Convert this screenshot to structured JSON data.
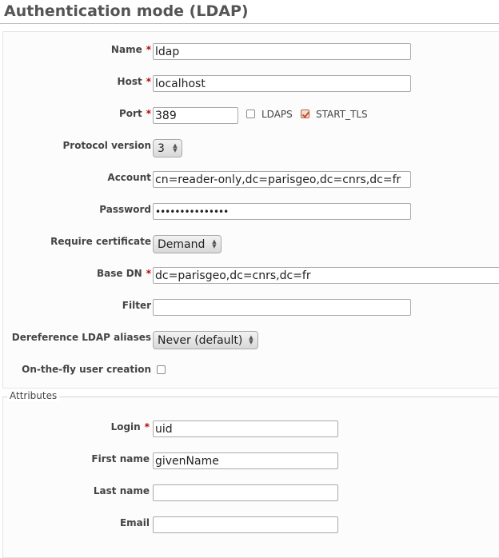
{
  "title": "Authentication mode (LDAP)",
  "required_mark": "*",
  "form": {
    "name": {
      "label": "Name",
      "value": "ldap"
    },
    "host": {
      "label": "Host",
      "value": "localhost"
    },
    "port": {
      "label": "Port",
      "value": "389",
      "ldaps_label": "LDAPS",
      "ldaps_checked": false,
      "start_tls_label": "START_TLS",
      "start_tls_checked": true
    },
    "protocol_version": {
      "label": "Protocol version",
      "value": "3"
    },
    "account": {
      "label": "Account",
      "value": "cn=reader-only,dc=parisgeo,dc=cnrs,dc=fr"
    },
    "password": {
      "label": "Password",
      "value": "•••••••••••••••"
    },
    "require_certificate": {
      "label": "Require certificate",
      "value": "Demand"
    },
    "base_dn": {
      "label": "Base DN",
      "value": "dc=parisgeo,dc=cnrs,dc=fr"
    },
    "filter": {
      "label": "Filter",
      "value": ""
    },
    "dereference": {
      "label": "Dereference LDAP aliases",
      "value": "Never (default)"
    },
    "onthefly": {
      "label": "On-the-fly user creation",
      "checked": false
    }
  },
  "attributes": {
    "legend": "Attributes",
    "login": {
      "label": "Login",
      "value": "uid"
    },
    "firstname": {
      "label": "First name",
      "value": "givenName"
    },
    "lastname": {
      "label": "Last name",
      "value": ""
    },
    "email": {
      "label": "Email",
      "value": ""
    }
  },
  "colors": {
    "required": "#bb0000",
    "checkbox_accent": "#d14a1e"
  }
}
